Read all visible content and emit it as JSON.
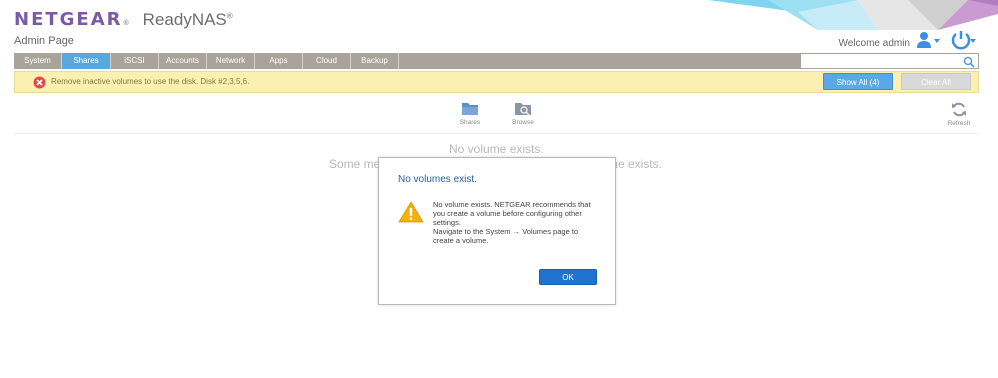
{
  "header": {
    "brand": "NETGEAR",
    "brand_mark": "®",
    "product": "ReadyNAS",
    "product_mark": "®",
    "subtitle": "Admin Page",
    "welcome": "Welcome admin"
  },
  "tabs": [
    {
      "label": "System"
    },
    {
      "label": "Shares",
      "active": true
    },
    {
      "label": "iSCSI"
    },
    {
      "label": "Accounts"
    },
    {
      "label": "Network"
    },
    {
      "label": "Apps"
    },
    {
      "label": "Cloud"
    },
    {
      "label": "Backup"
    }
  ],
  "search": {
    "placeholder": ""
  },
  "alert": {
    "text": "Remove inactive volumes to use the disk. Disk #2,3,5,6.",
    "show_all_label": "Show All (4)",
    "clear_all_label": "Clear All"
  },
  "toolbar": {
    "shares_label": "Shares",
    "browse_label": "Browse",
    "refresh_label": "Refresh"
  },
  "background": {
    "line1": "No volume exists.",
    "line2_left": "Some me",
    "line2_right": "me exists."
  },
  "modal": {
    "title": "No volumes exist.",
    "body1": "No volume exists. NETGEAR recommends that you create a volume before configuring other settings.",
    "body2": "Navigate to the System → Volumes page to create a volume.",
    "ok_label": "OK"
  },
  "colors": {
    "brand": "#7b5aa6",
    "tab_active": "#58a8df",
    "tab_bg": "#a9a399",
    "alert_bg": "#fbf0b2",
    "primary_button": "#1f74d1",
    "accent_blue": "#5aa9e6"
  }
}
